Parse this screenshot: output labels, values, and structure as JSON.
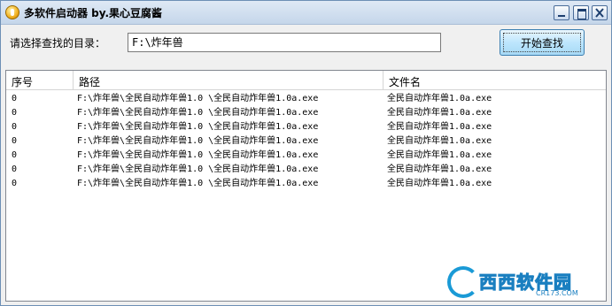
{
  "window": {
    "title": "多软件启动器 by.果心豆腐酱"
  },
  "search": {
    "dir_label": "请选择查找的目录：",
    "dir_value": "F:\\炸年兽",
    "button_label": "开始查找"
  },
  "table": {
    "headers": [
      "序号",
      "路径",
      "文件名"
    ],
    "rows": [
      {
        "idx": "0",
        "path": "F:\\炸年兽\\全民自动炸年兽1.0  \\全民自动炸年兽1.0a.exe",
        "name": "全民自动炸年兽1.0a.exe"
      },
      {
        "idx": "0",
        "path": "F:\\炸年兽\\全民自动炸年兽1.0  \\全民自动炸年兽1.0a.exe",
        "name": "全民自动炸年兽1.0a.exe"
      },
      {
        "idx": "0",
        "path": "F:\\炸年兽\\全民自动炸年兽1.0  \\全民自动炸年兽1.0a.exe",
        "name": "全民自动炸年兽1.0a.exe"
      },
      {
        "idx": "0",
        "path": "F:\\炸年兽\\全民自动炸年兽1.0  \\全民自动炸年兽1.0a.exe",
        "name": "全民自动炸年兽1.0a.exe"
      },
      {
        "idx": "0",
        "path": "F:\\炸年兽\\全民自动炸年兽1.0  \\全民自动炸年兽1.0a.exe",
        "name": "全民自动炸年兽1.0a.exe"
      },
      {
        "idx": "0",
        "path": "F:\\炸年兽\\全民自动炸年兽1.0  \\全民自动炸年兽1.0a.exe",
        "name": "全民自动炸年兽1.0a.exe"
      },
      {
        "idx": "0",
        "path": "F:\\炸年兽\\全民自动炸年兽1.0  \\全民自动炸年兽1.0a.exe",
        "name": "全民自动炸年兽1.0a.exe"
      }
    ]
  },
  "watermark": {
    "text": "西西软件园",
    "sub": "CR173.COM"
  },
  "colors": {
    "accent": "#1a9ad6",
    "button_border": "#3c7fb1"
  }
}
